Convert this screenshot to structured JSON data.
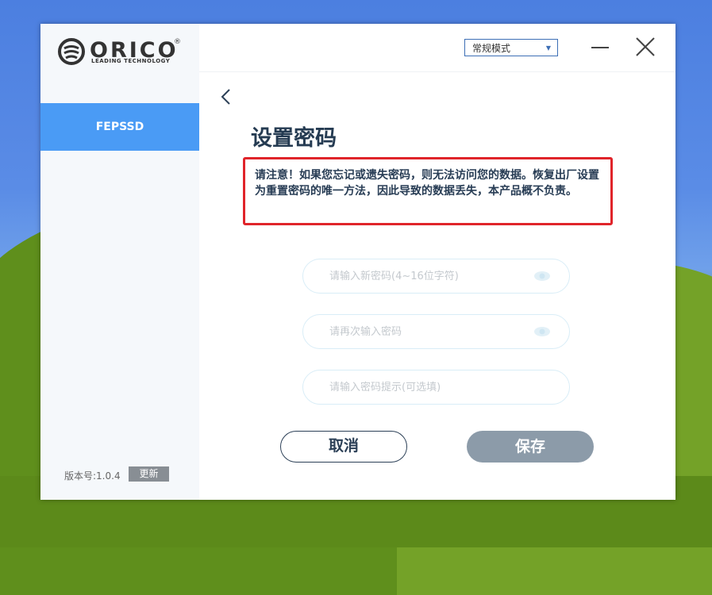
{
  "brand": {
    "name": "ORICO",
    "tagline": "LEADING TECHNOLOGY",
    "reg_mark": "®"
  },
  "sidebar": {
    "items": [
      {
        "label": "FEPSSD",
        "active": true
      }
    ],
    "version_label": "版本号:1.0.4",
    "update_label": "更新"
  },
  "topbar": {
    "mode_value": "常规模式"
  },
  "main": {
    "title": "设置密码",
    "warning": "请注意！如果您忘记或遗失密码，则无法访问您的数据。恢复出厂设置为重置密码的唯一方法，因此导致的数据丢失，本产品概不负责。",
    "fields": {
      "new_password": {
        "value": "",
        "placeholder": "请输入新密码(4~16位字符)"
      },
      "confirm_password": {
        "value": "",
        "placeholder": "请再次输入密码"
      },
      "hint": {
        "value": "",
        "placeholder": "请输入密码提示(可选填)"
      }
    },
    "cancel_label": "取消",
    "save_label": "保存"
  },
  "colors": {
    "accent": "#4a9bf5",
    "warning_border": "#e0242a",
    "title": "#253b52",
    "save_disabled": "#8c9ba9"
  },
  "icons": [
    "orico-logo-icon",
    "back-chevron-icon",
    "minimize-icon",
    "close-icon",
    "eye-icon",
    "dropdown-caret-icon"
  ]
}
